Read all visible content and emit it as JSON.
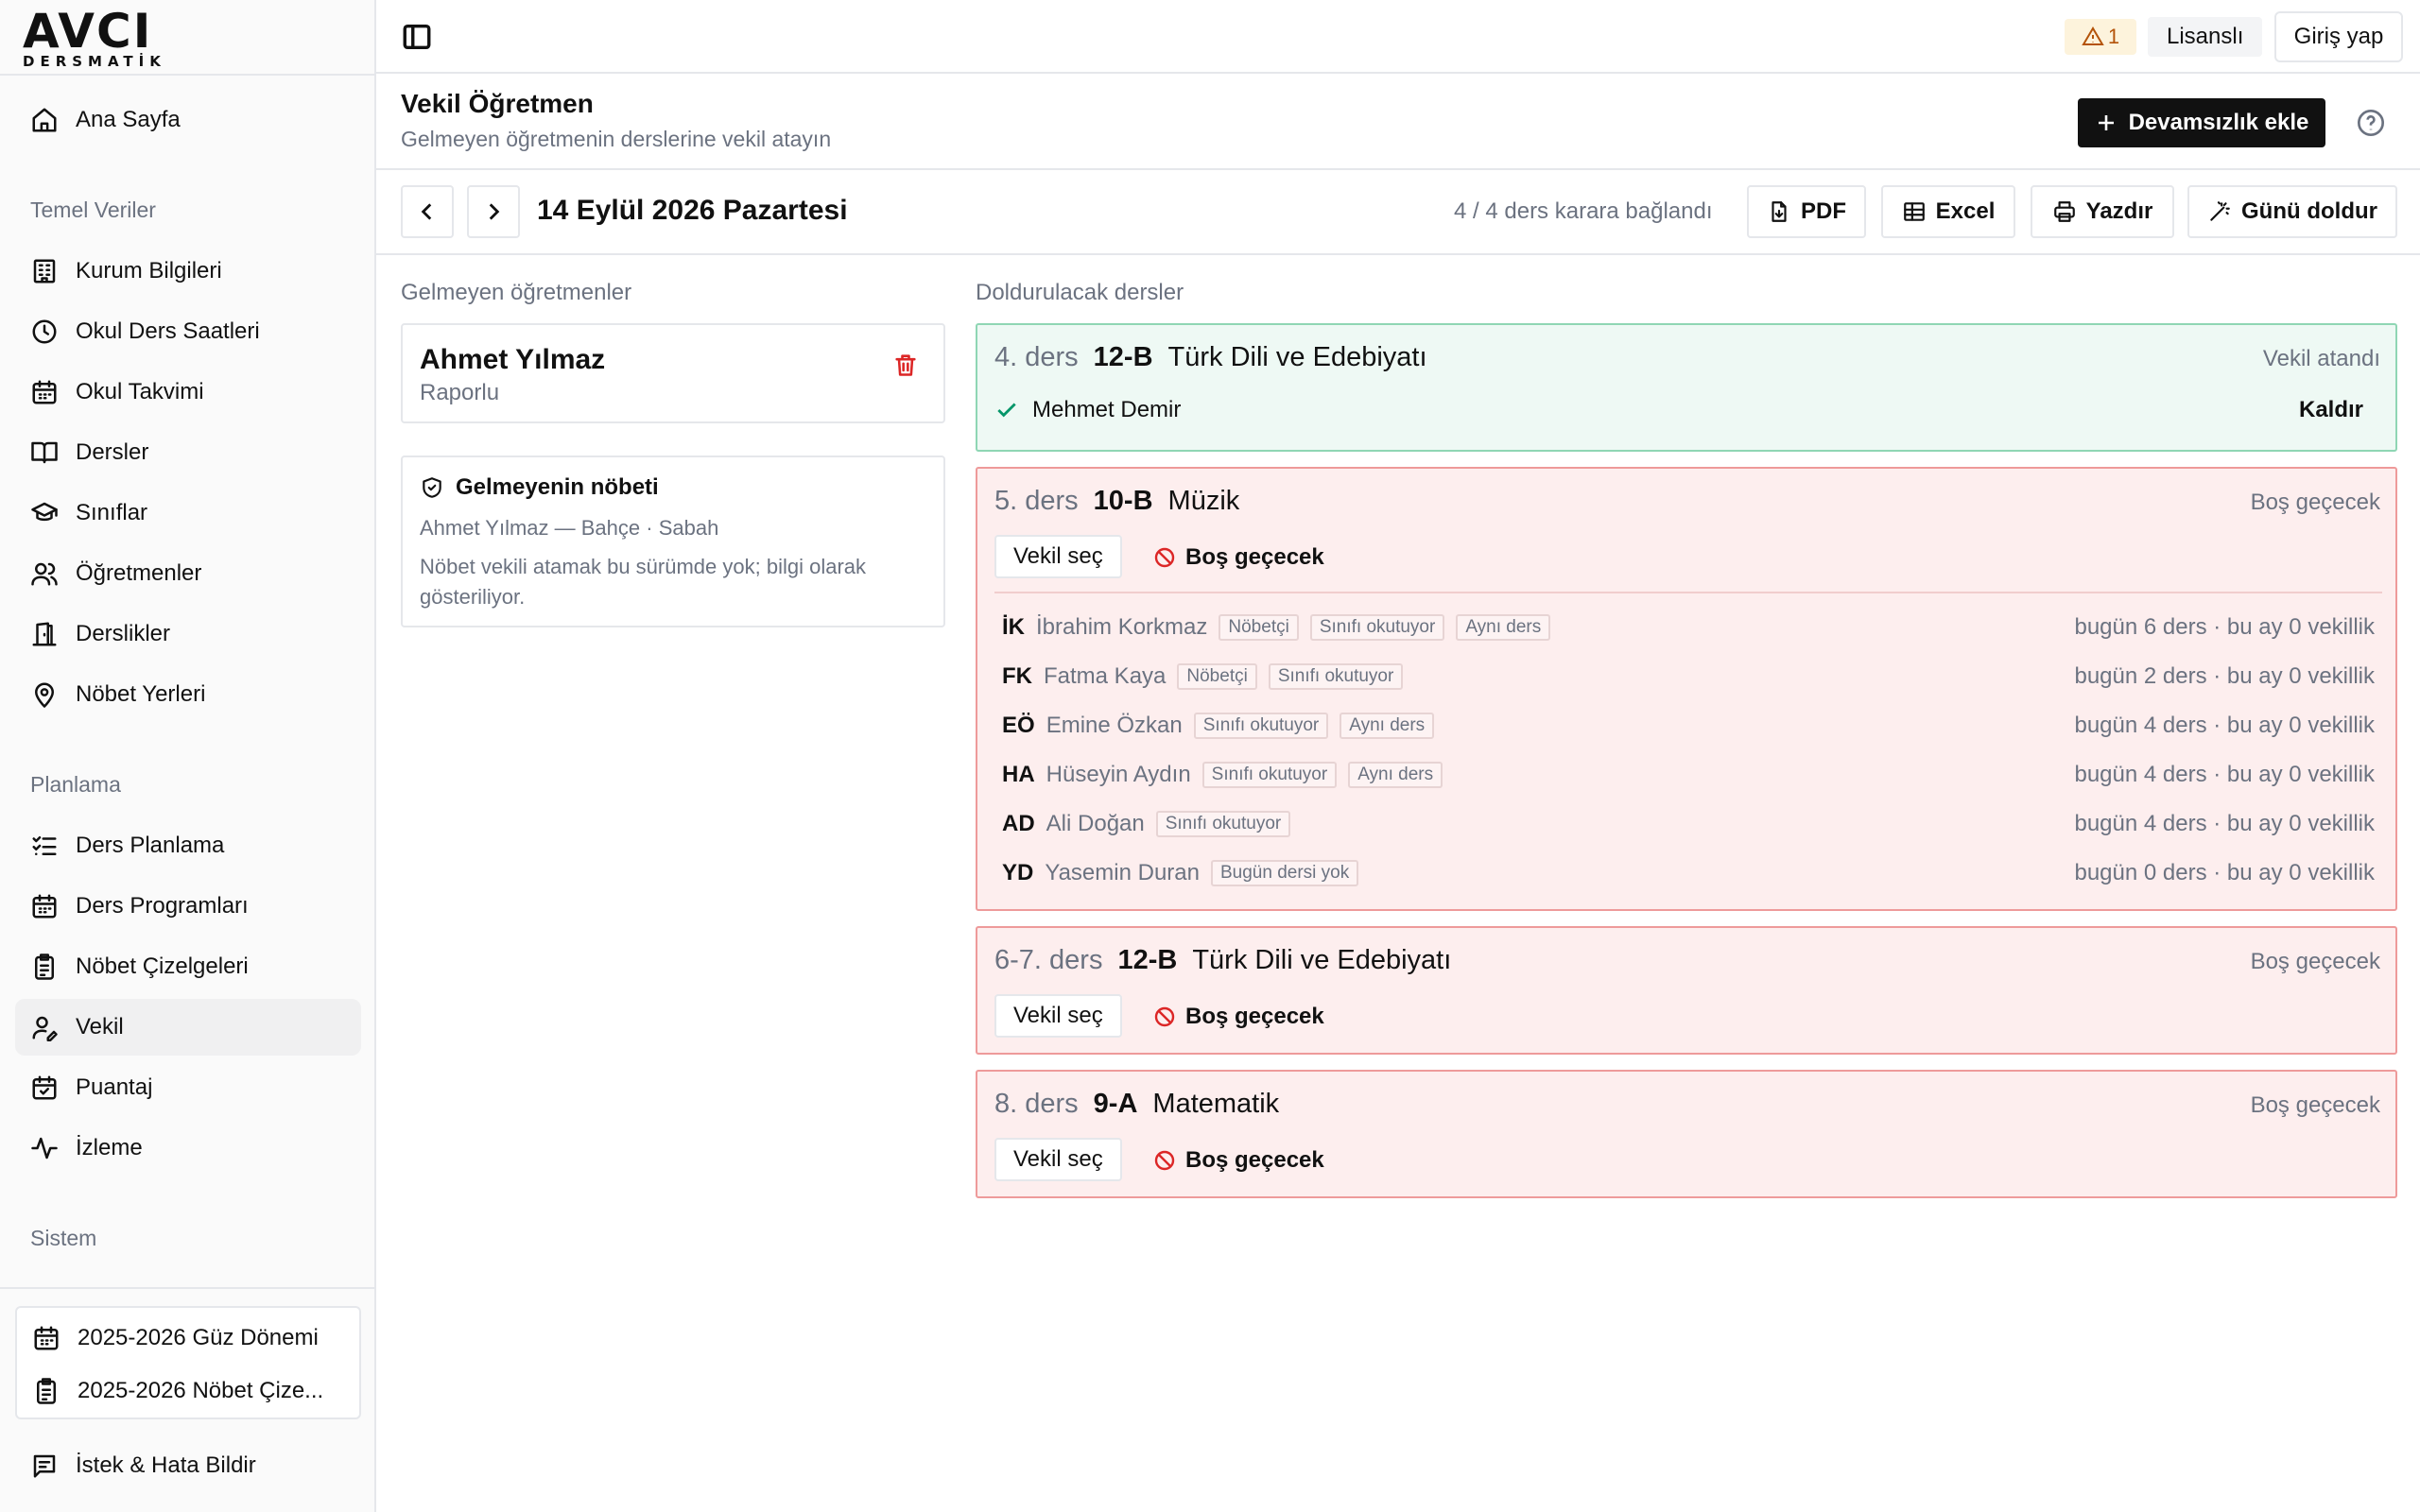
{
  "brand": {
    "name": "AVCI",
    "tagline": "DERSMATİK"
  },
  "sidebar": {
    "home": "Ana Sayfa",
    "sections": [
      {
        "label": "Temel Veriler",
        "items": [
          "Kurum Bilgileri",
          "Okul Ders Saatleri",
          "Okul Takvimi",
          "Dersler",
          "Sınıflar",
          "Öğretmenler",
          "Derslikler",
          "Nöbet Yerleri"
        ]
      },
      {
        "label": "Planlama",
        "items": [
          "Ders Planlama",
          "Ders Programları",
          "Nöbet Çizelgeleri",
          "Vekil",
          "Puantaj",
          "İzleme"
        ]
      },
      {
        "label": "Sistem",
        "items": []
      }
    ],
    "active": "Vekil",
    "periods": [
      "2025-2026 Güz Dönemi",
      "2025-2026 Nöbet Çize..."
    ],
    "feedback": "İstek & Hata Bildir"
  },
  "header": {
    "warning_count": "1",
    "license": "Lisanslı",
    "login": "Giriş yap"
  },
  "page": {
    "title": "Vekil Öğretmen",
    "subtitle": "Gelmeyen öğretmenin derslerine vekil atayın",
    "add_button": "Devamsızlık ekle"
  },
  "toolbar": {
    "date": "14 Eylül 2026 Pazartesi",
    "progress": "4 / 4 ders karara bağlandı",
    "pdf": "PDF",
    "excel": "Excel",
    "print": "Yazdır",
    "fill": "Günü doldur"
  },
  "absent": {
    "title": "Gelmeyen öğretmenler",
    "name": "Ahmet Yılmaz",
    "reason": "Raporlu",
    "duty_title": "Gelmeyenin nöbeti",
    "duty_info": "Ahmet Yılmaz — Bahçe · Sabah",
    "duty_note": "Nöbet vekili atamak bu sürümde yok; bilgi olarak gösteriliyor."
  },
  "lessons": {
    "title": "Doldurulacak dersler",
    "pick_label": "Vekil seç",
    "skip_label": "Boş geçecek",
    "items": [
      {
        "no": "4. ders",
        "class": "12-B",
        "subject": "Türk Dili ve Edebiyatı",
        "status": "Vekil atandı",
        "assigned": "Mehmet Demir",
        "remove": "Kaldır"
      },
      {
        "no": "5. ders",
        "class": "10-B",
        "subject": "Müzik",
        "status": "Boş geçecek"
      },
      {
        "no": "6-7. ders",
        "class": "12-B",
        "subject": "Türk Dili ve Edebiyatı",
        "status": "Boş geçecek"
      },
      {
        "no": "8. ders",
        "class": "9-A",
        "subject": "Matematik",
        "status": "Boş geçecek"
      }
    ],
    "candidates": [
      {
        "initials": "İK",
        "name": "İbrahim Korkmaz",
        "tags": [
          "Nöbetçi",
          "Sınıfı okutuyor",
          "Aynı ders"
        ],
        "stats": "bugün 6 ders · bu ay 0 vekillik"
      },
      {
        "initials": "FK",
        "name": "Fatma Kaya",
        "tags": [
          "Nöbetçi",
          "Sınıfı okutuyor"
        ],
        "stats": "bugün 2 ders · bu ay 0 vekillik"
      },
      {
        "initials": "EÖ",
        "name": "Emine Özkan",
        "tags": [
          "Sınıfı okutuyor",
          "Aynı ders"
        ],
        "stats": "bugün 4 ders · bu ay 0 vekillik"
      },
      {
        "initials": "HA",
        "name": "Hüseyin Aydın",
        "tags": [
          "Sınıfı okutuyor",
          "Aynı ders"
        ],
        "stats": "bugün 4 ders · bu ay 0 vekillik"
      },
      {
        "initials": "AD",
        "name": "Ali Doğan",
        "tags": [
          "Sınıfı okutuyor"
        ],
        "stats": "bugün 4 ders · bu ay 0 vekillik"
      },
      {
        "initials": "YD",
        "name": "Yasemin Duran",
        "tags": [
          "Bugün dersi yok"
        ],
        "stats": "bugün 0 ders · bu ay 0 vekillik"
      }
    ]
  }
}
